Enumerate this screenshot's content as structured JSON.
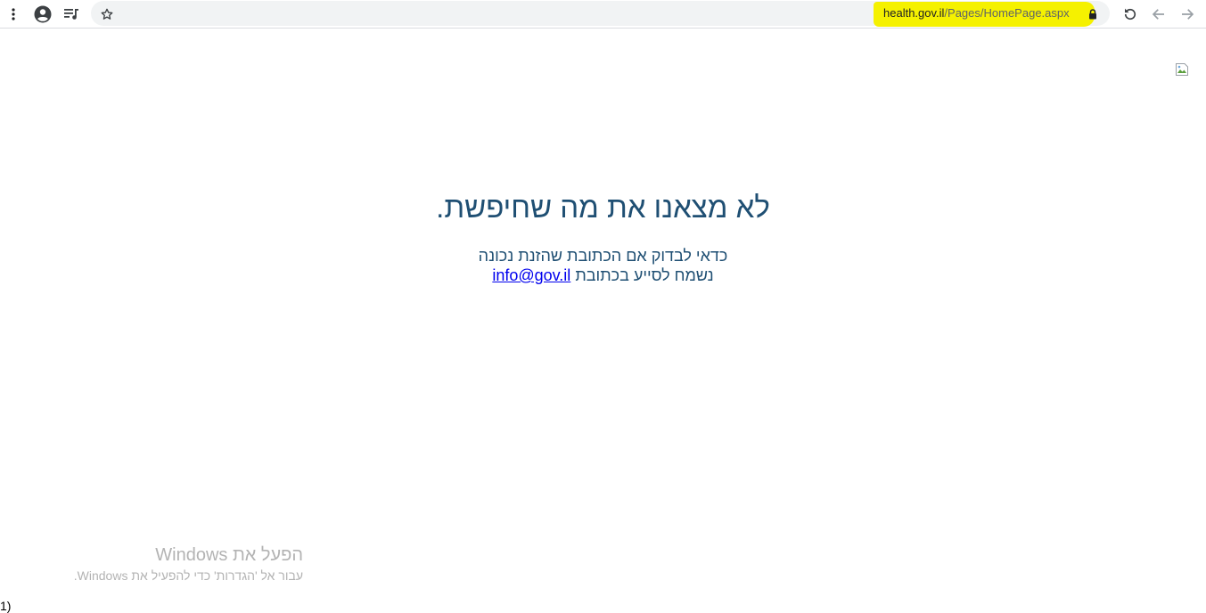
{
  "browser": {
    "url_domain": "health.gov.il",
    "url_path": "/Pages/HomePage.aspx",
    "icons": {
      "menu": "kebab-menu-icon",
      "profile": "account-circle-icon",
      "playlist": "media-queue-icon",
      "bookmark": "star-icon",
      "secure": "lock-icon",
      "reload": "reload-icon",
      "back": "arrow-back-icon",
      "forward": "arrow-forward-icon"
    },
    "highlight_color": "#f5f100"
  },
  "page": {
    "title": "לא מצאנו את מה שחיפשת.",
    "line1": "כדאי לבדוק אם הכתובת שהזנת נכונה",
    "line2_prefix": "נשמח לסייע בכתובת",
    "email": "info@gov.il",
    "text_color": "#1f4f73"
  },
  "watermark": {
    "title": "הפעל את Windows",
    "subtitle": "עבור אל 'הגדרות' כדי להפעיל את Windows."
  },
  "corner_text": "1)"
}
